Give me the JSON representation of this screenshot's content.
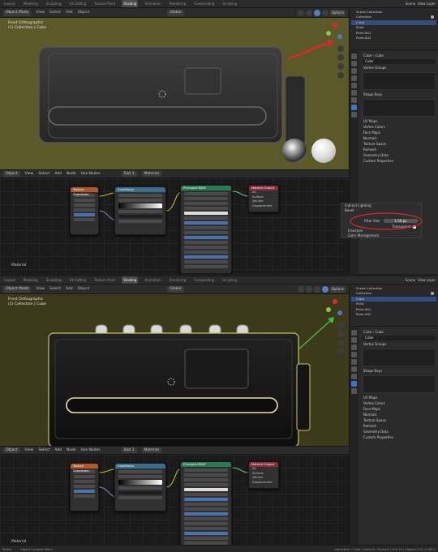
{
  "workspace_tabs": [
    "Layout",
    "Modeling",
    "Sculpting",
    "UV Editing",
    "Texture Paint",
    "Shading",
    "Animation",
    "Rendering",
    "Compositing",
    "Scripting"
  ],
  "active_workspace": "Shading",
  "scene": "Scene",
  "view_layer": "View Layer",
  "viewport_header": {
    "mode": "Object Mode",
    "menus": [
      "View",
      "Select",
      "Add",
      "Object"
    ],
    "orientation": "Global",
    "options": "Options"
  },
  "viewport_info": {
    "line1": "Front Orthographic",
    "line2": "(1) Collection | Cube"
  },
  "node_header": {
    "type": "Object",
    "menus": [
      "View",
      "Select",
      "Add",
      "Node"
    ],
    "use_nodes": "Use Nodes",
    "slot": "Slot 1",
    "material": "Material"
  },
  "nodes": {
    "texcoord": "Texture Coordinate",
    "colorramp": "ColorRamp",
    "bsdf": "Principled BSDF",
    "output": "Material Output",
    "output_rows": [
      "All",
      "Surface",
      "Volume",
      "Displacement"
    ]
  },
  "node_editor_label": "Material",
  "outliner": {
    "title": "Scene Collection",
    "items": [
      "Collection",
      "Cube",
      "Point",
      "Point.001",
      "Point.002"
    ]
  },
  "properties": {
    "object": "Cube",
    "data": "Cube",
    "mesh_name": "Cube",
    "vertex_groups": "Vertex Groups",
    "shape_keys": "Shape Keys",
    "panels": [
      "UV Maps",
      "Vertex Colors",
      "Face Maps",
      "Normals",
      "Texture Space",
      "Remesh",
      "Geometry Data",
      "Custom Properties"
    ]
  },
  "bevel_popup": {
    "title": "Indirect Lighting",
    "row2": "Bevel",
    "filter_size_label": "Filter Size",
    "filter_size_value": "1.50 px",
    "transparent_label": "Transparent",
    "row_after": "Freestyle",
    "last_row": "Color Management"
  },
  "statusbar": {
    "left": "Select",
    "middle": "Object Context Menu",
    "right": "Collection | Cube | Verts:8 | Faces:6 | Tris:12 | Objects:1/3 | 2.83.2"
  },
  "colors": {
    "annotation_red": "#e0262b",
    "annotation_green": "#3fbf3f",
    "select_blue": "#3b78c3"
  }
}
